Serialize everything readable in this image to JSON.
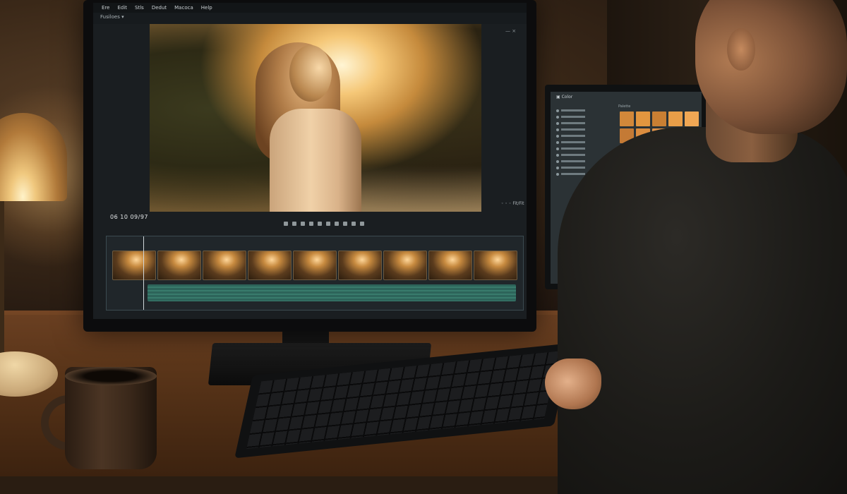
{
  "editor": {
    "menu": [
      "Ere",
      "Edit",
      "Stls",
      "Dedut",
      "Macoca",
      "Help"
    ],
    "panel_label": "Fusiloes ▾",
    "window_controls": "— ×",
    "timecode": "06 10 09/97",
    "zoom_label": "◦ ◦ ◦ Fit/Fit"
  },
  "secondary": {
    "title": "▣ Color",
    "tab": "Palette",
    "list_rows": 11,
    "swatch_colors": [
      "#d2883a",
      "#e2963f",
      "#c97f33",
      "#e89e48",
      "#f0a754",
      "#c47a35",
      "#db8d3f",
      "#e0934a",
      "#cf8439",
      "#eda052",
      "#d98b3c",
      "#e4974a",
      "#c97d34",
      "#e69a45",
      "#f2ab59",
      "#cc7f36",
      "#df9144",
      "#d0863b",
      "#e59a47",
      "#efa756",
      "#d58839",
      "#e09346",
      "#ca7e35",
      "#e39848",
      "#eca250",
      "#c98035",
      "#d78d40",
      "#c47c33",
      "#e0944a",
      "#e7a04f",
      "#cd8136",
      "#d3893d",
      "#c77e34",
      "#dc9044",
      "#e49a4b"
    ]
  }
}
